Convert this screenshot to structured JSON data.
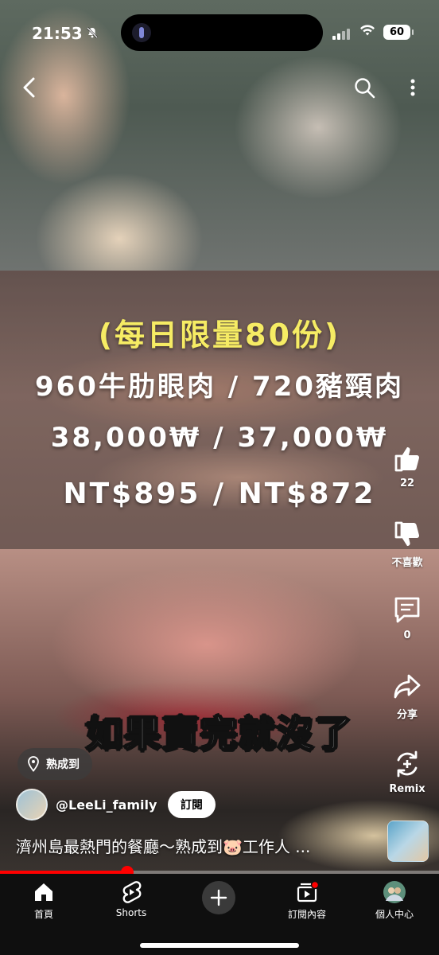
{
  "status_bar": {
    "time": "21:53",
    "battery": "60"
  },
  "video": {
    "overlay_lines": [
      "(每日限量80份)",
      "960牛肋眼肉 / 720豬頸肉",
      "38,000₩ / 37,000₩",
      "NT$895 / NT$872"
    ],
    "caption": "如果賣完就沒了",
    "location_tag": "熟成到",
    "channel_handle": "@LeeLi_family",
    "subscribe_label": "訂閱",
    "title": "濟州島最熱門的餐廳～熟成到🐷工作人 ...",
    "progress_fraction": 0.29
  },
  "actions": {
    "like_count": "22",
    "dislike_label": "不喜歡",
    "comment_count": "0",
    "share_label": "分享",
    "remix_label": "Remix"
  },
  "bottom_nav": {
    "home": "首頁",
    "shorts": "Shorts",
    "subscriptions": "訂閱內容",
    "profile": "個人中心"
  },
  "icons": [
    "back-arrow-icon",
    "search-icon",
    "more-vert-icon",
    "like-icon",
    "dislike-icon",
    "comment-icon",
    "share-icon",
    "remix-icon",
    "location-pin-icon",
    "home-icon",
    "shorts-icon",
    "plus-icon",
    "subscriptions-icon"
  ],
  "colors": {
    "accent_red": "#ff0000",
    "highlight_yellow": "#f6ec64",
    "nav_background": "#0f0f0f"
  }
}
